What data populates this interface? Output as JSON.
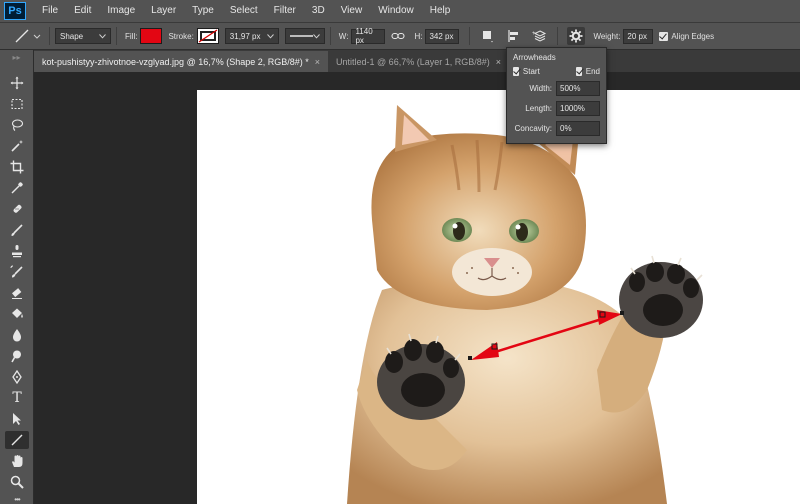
{
  "app": {
    "logo": "Ps"
  },
  "menu": [
    "File",
    "Edit",
    "Image",
    "Layer",
    "Type",
    "Select",
    "Filter",
    "3D",
    "View",
    "Window",
    "Help"
  ],
  "options": {
    "mode": "Shape",
    "fill_label": "Fill:",
    "fill_color": "#e30613",
    "stroke_label": "Stroke:",
    "stroke_width": "31,97 px",
    "w_label": "W:",
    "w_value": "1140 px",
    "h_label": "H:",
    "h_value": "342 px",
    "weight_label": "Weight:",
    "weight_value": "20 px",
    "align_edges_label": "Align Edges",
    "align_edges_checked": true
  },
  "tabs": [
    {
      "label": "kot-pushistyy-zhivotnoe-vzglyad.jpg @ 16,7% (Shape 2, RGB/8#) *",
      "close": "×",
      "active": true
    },
    {
      "label": "Untitled-1 @ 66,7% (Layer 1, RGB/8#)",
      "close": "×",
      "active": false
    }
  ],
  "arrowheads_popup": {
    "title": "Arrowheads",
    "start_label": "Start",
    "start_checked": true,
    "end_label": "End",
    "end_checked": true,
    "width_label": "Width:",
    "width_value": "500%",
    "length_label": "Length:",
    "length_value": "1000%",
    "concavity_label": "Concavity:",
    "concavity_value": "0%"
  },
  "toolbar": {
    "grip": "▸▸",
    "tools": [
      "move-icon",
      "marquee-icon",
      "lasso-icon",
      "magic-wand-icon",
      "crop-icon",
      "eyedropper-icon",
      "healing-brush-icon",
      "brush-icon",
      "clone-stamp-icon",
      "history-brush-icon",
      "eraser-icon",
      "paint-bucket-icon",
      "blur-icon",
      "dodge-icon",
      "pen-icon",
      "type-icon",
      "path-selection-icon",
      "line-tool-icon",
      "hand-icon",
      "zoom-icon",
      "more-tools-icon"
    ],
    "selected_tool": "line-tool-icon",
    "type_tool_glyph": "T",
    "more_glyph": "•••"
  },
  "canvas": {
    "arrow_color": "#e30613"
  }
}
